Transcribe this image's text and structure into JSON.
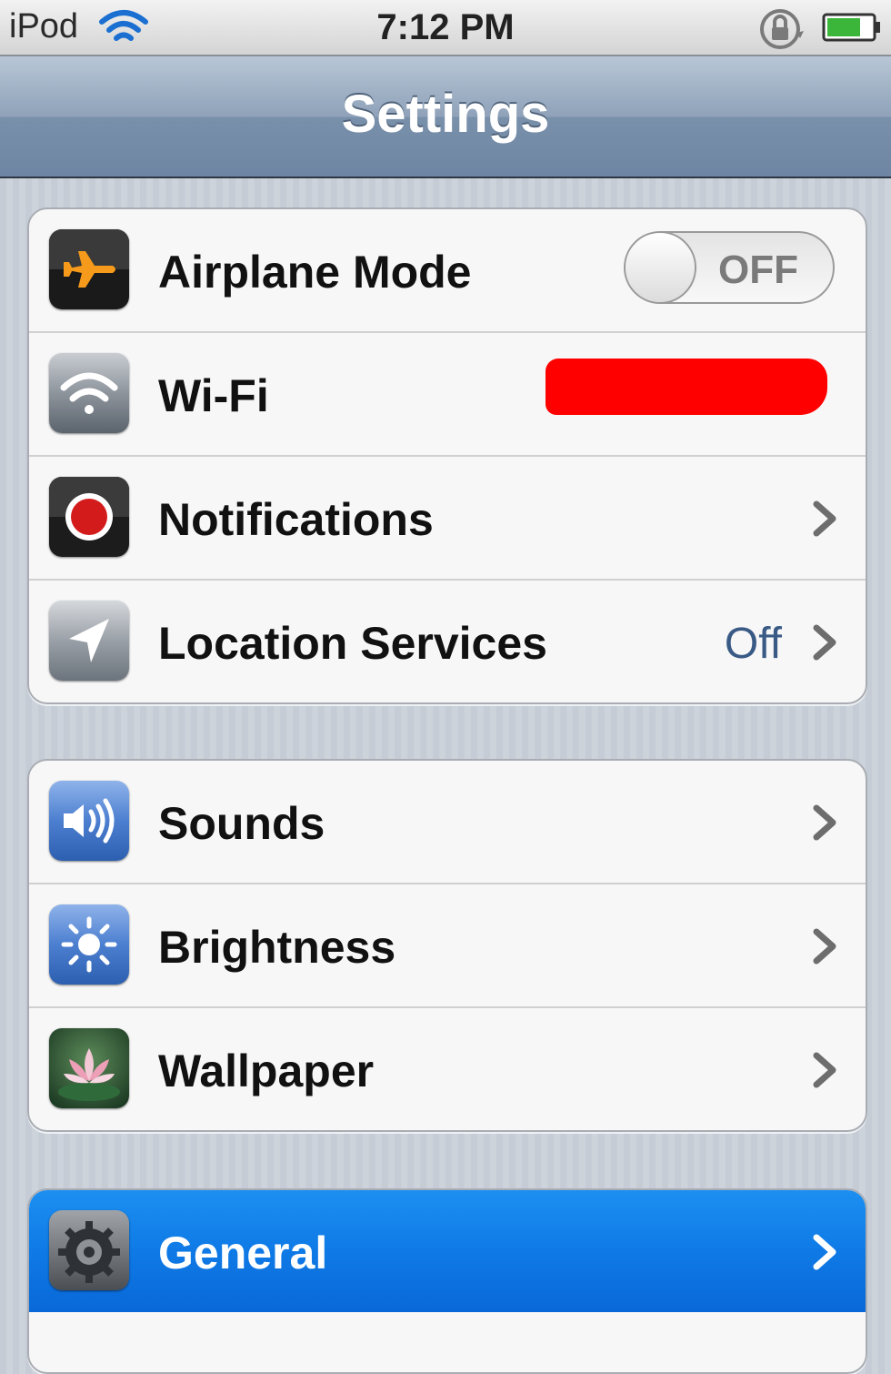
{
  "status_bar": {
    "carrier": "iPod",
    "time": "7:12 PM",
    "icons": [
      "wifi-icon",
      "rotation-lock-icon",
      "battery-icon"
    ]
  },
  "nav": {
    "title": "Settings"
  },
  "groups": [
    {
      "rows": [
        {
          "label": "Airplane Mode",
          "icon": "airplane-icon",
          "toggle": "OFF"
        },
        {
          "label": "Wi-Fi",
          "icon": "wifi-icon",
          "value_redacted": true
        },
        {
          "label": "Notifications",
          "icon": "notifications-icon"
        },
        {
          "label": "Location Services",
          "icon": "location-arrow-icon",
          "value": "Off"
        }
      ]
    },
    {
      "rows": [
        {
          "label": "Sounds",
          "icon": "speaker-icon"
        },
        {
          "label": "Brightness",
          "icon": "sun-icon"
        },
        {
          "label": "Wallpaper",
          "icon": "lotus-flower-icon"
        }
      ]
    },
    {
      "rows": [
        {
          "label": "General",
          "icon": "gear-icon",
          "selected": true
        }
      ]
    }
  ],
  "colors": {
    "selected_row": "#0f7ae6",
    "value_text": "#3a5a86",
    "redaction": "#ff0000"
  }
}
